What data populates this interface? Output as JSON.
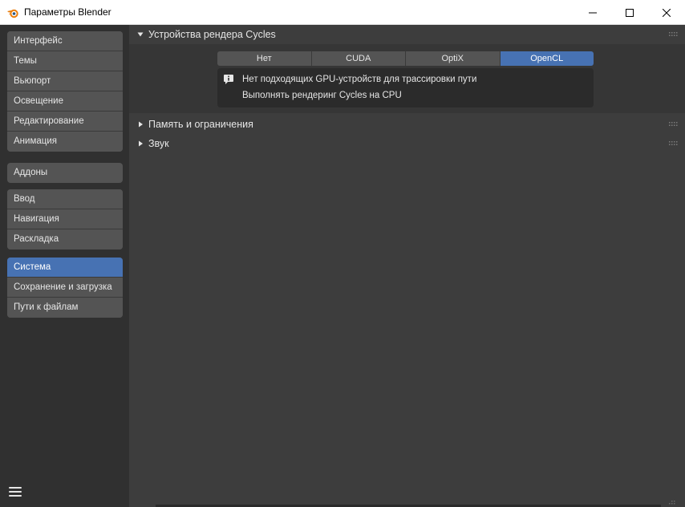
{
  "window": {
    "title": "Параметры Blender",
    "icons": {
      "app": "blender-logo-icon",
      "minimize": "minimize-icon",
      "maximize": "maximize-icon",
      "close": "close-icon"
    }
  },
  "sidebar": {
    "groups": [
      {
        "items": [
          {
            "label": "Интерфейс",
            "active": false
          },
          {
            "label": "Темы",
            "active": false
          },
          {
            "label": "Вьюпорт",
            "active": false
          },
          {
            "label": "Освещение",
            "active": false
          },
          {
            "label": "Редактирование",
            "active": false
          },
          {
            "label": "Анимация",
            "active": false
          }
        ]
      },
      {
        "items": [
          {
            "label": "Аддоны",
            "active": false
          }
        ]
      },
      {
        "items": [
          {
            "label": "Ввод",
            "active": false
          },
          {
            "label": "Навигация",
            "active": false
          },
          {
            "label": "Раскладка",
            "active": false
          }
        ]
      },
      {
        "items": [
          {
            "label": "Система",
            "active": true
          },
          {
            "label": "Сохранение и загрузка",
            "active": false
          },
          {
            "label": "Пути к файлам",
            "active": false
          }
        ]
      }
    ],
    "menu_icon": "hamburger-menu-icon"
  },
  "main": {
    "panels": [
      {
        "title": "Устройства рендера Cycles",
        "expanded": true,
        "device_options": [
          "Нет",
          "CUDA",
          "OptiX",
          "OpenCL"
        ],
        "selected_device": "OpenCL",
        "info": {
          "icon": "info-icon",
          "line1": "Нет подходящих GPU-устройств для трассировки пути",
          "line2": "Выполнять рендеринг Cycles на CPU"
        }
      },
      {
        "title": "Память и ограничения",
        "expanded": false
      },
      {
        "title": "Звук",
        "expanded": false
      }
    ]
  },
  "colors": {
    "accent": "#4772b3",
    "sidebar_bg": "#303030",
    "main_bg": "#3d3d3d",
    "button_bg": "#545454",
    "text": "#e6e6e6"
  }
}
